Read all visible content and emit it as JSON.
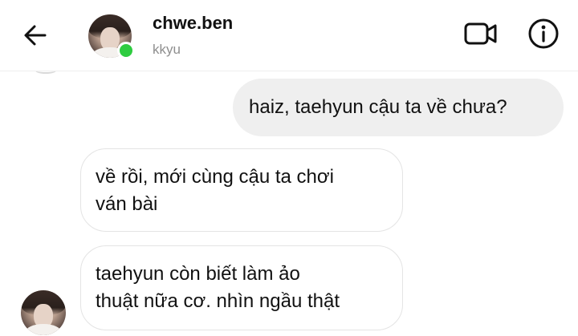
{
  "header": {
    "back_icon": "arrow-left-icon",
    "contact_name": "chwe.ben",
    "contact_subtitle": "kkyu",
    "online_status_color": "#2ecc40",
    "video_icon": "video-camera-icon",
    "info_icon": "info-icon"
  },
  "messages": [
    {
      "direction": "outgoing",
      "lines": [
        "haiz, taehyun cậu ta về chưa?"
      ]
    },
    {
      "direction": "incoming",
      "lines": [
        "về rồi, mới cùng cậu ta chơi",
        "ván bài"
      ]
    },
    {
      "direction": "incoming",
      "lines": [
        "taehyun còn biết làm ảo",
        "thuật nữa cơ. nhìn ngầu thật"
      ]
    }
  ],
  "colors": {
    "outgoing_bubble": "#efefef",
    "incoming_bubble_border": "#e4e4e4",
    "text": "#111111",
    "subtitle": "#8e8e8e"
  }
}
